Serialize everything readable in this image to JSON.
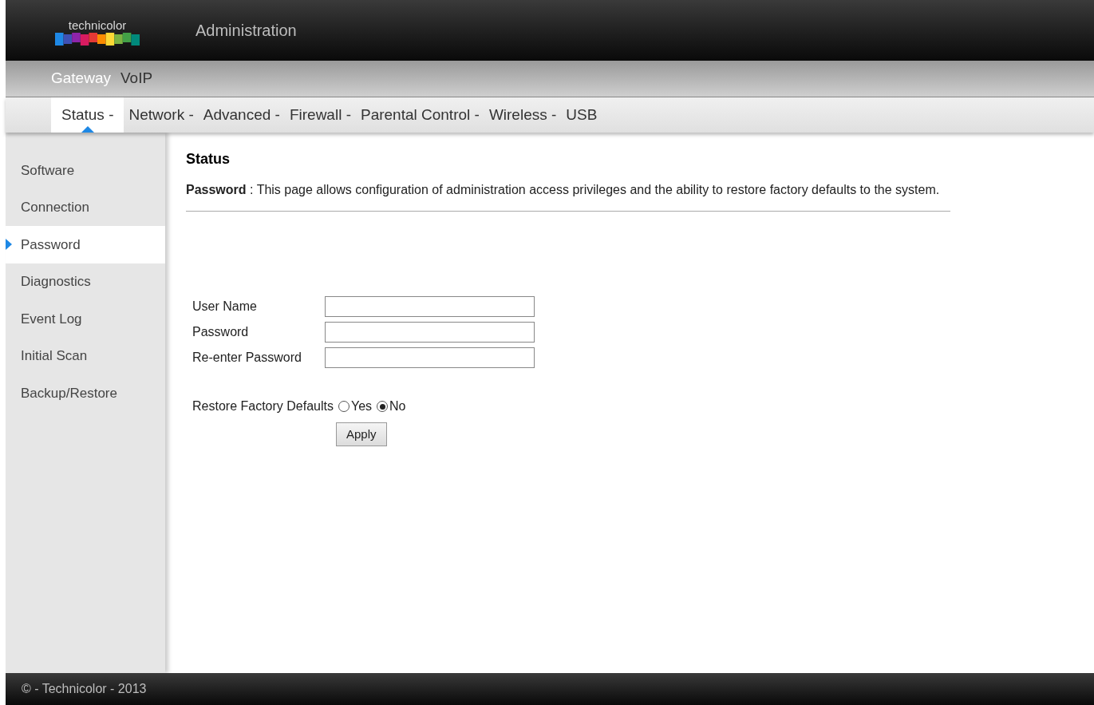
{
  "header": {
    "logo_text": "technicolor",
    "title": "Administration"
  },
  "main_nav": [
    {
      "label": "Gateway",
      "selected": true
    },
    {
      "label": "VoIP",
      "selected": false
    }
  ],
  "tabs": [
    {
      "label": "Status -",
      "selected": true
    },
    {
      "label": "Network -",
      "selected": false
    },
    {
      "label": "Advanced -",
      "selected": false
    },
    {
      "label": "Firewall -",
      "selected": false
    },
    {
      "label": "Parental Control -",
      "selected": false
    },
    {
      "label": "Wireless -",
      "selected": false
    },
    {
      "label": "USB",
      "selected": false
    }
  ],
  "sidebar": {
    "items": [
      {
        "label": "Software",
        "selected": false
      },
      {
        "label": "Connection",
        "selected": false
      },
      {
        "label": "Password",
        "selected": true
      },
      {
        "label": "Diagnostics",
        "selected": false
      },
      {
        "label": "Event Log",
        "selected": false
      },
      {
        "label": "Initial Scan",
        "selected": false
      },
      {
        "label": "Backup/Restore",
        "selected": false
      }
    ]
  },
  "content": {
    "heading": "Status",
    "description": "**Password**  :  This page allows configuration of administration access privileges and the ability to restore factory defaults to the system.",
    "fields": [
      {
        "label": "User Name"
      },
      {
        "label": "Password"
      },
      {
        "label": "Re-enter Password"
      }
    ],
    "restore": {
      "label": "Restore Factory Defaults",
      "options": [
        {
          "label": "Yes",
          "selected": false
        },
        {
          "label": "No",
          "selected": true
        }
      ]
    },
    "apply_button": "Apply"
  },
  "footer": "© - Technicolor - 2013"
}
